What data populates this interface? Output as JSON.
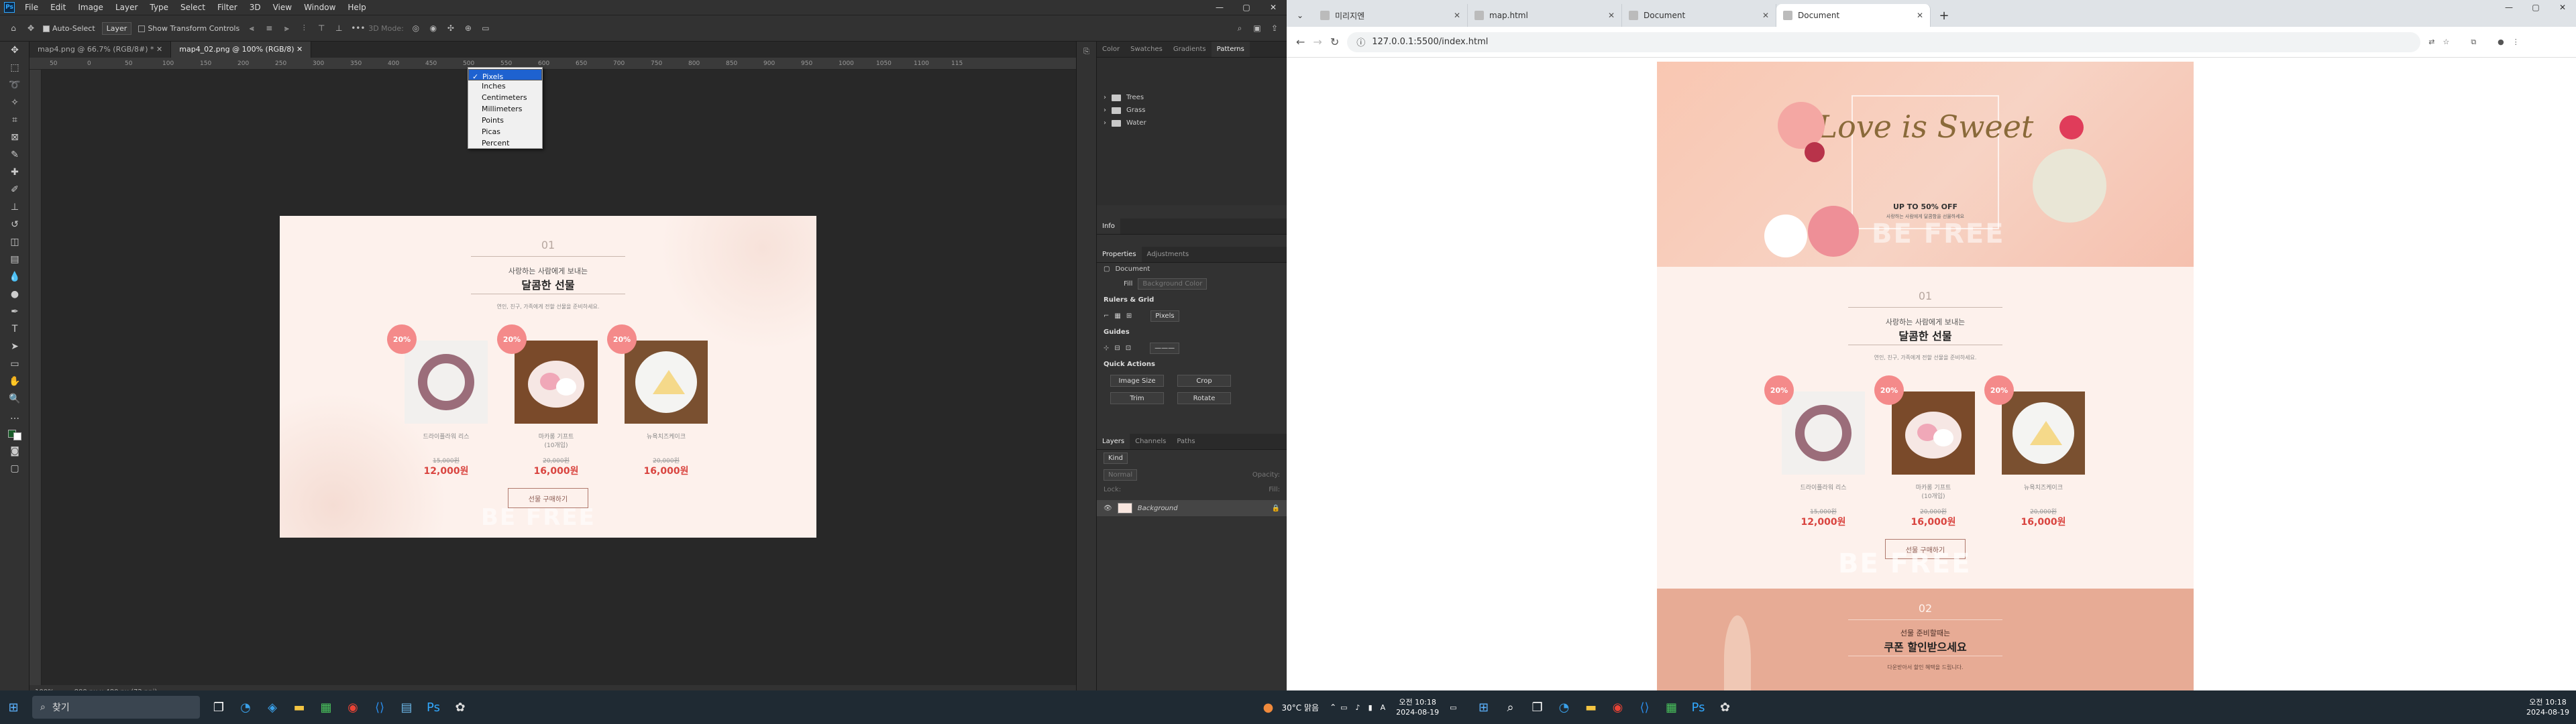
{
  "photoshop": {
    "menu": [
      "File",
      "Edit",
      "Image",
      "Layer",
      "Type",
      "Select",
      "Filter",
      "3D",
      "View",
      "Window",
      "Help"
    ],
    "options": {
      "auto_select": "Auto-Select",
      "layer_select": "Layer",
      "show_transform": "Show Transform Controls",
      "mode_3d": "3D Mode:"
    },
    "tabs": [
      "map4.png @ 66.7% (RGB/8#) *",
      "map4_02.png @ 100% (RGB/8)"
    ],
    "ruler_ticks": [
      "50",
      "0",
      "50",
      "100",
      "150",
      "200",
      "250",
      "300",
      "350",
      "400",
      "450",
      "500",
      "550",
      "600",
      "650",
      "700",
      "750",
      "800",
      "850",
      "900",
      "950",
      "1000",
      "1050",
      "1100",
      "115"
    ],
    "unit_menu": [
      "Pixels",
      "Inches",
      "Centimeters",
      "Millimeters",
      "Points",
      "Picas",
      "Percent"
    ],
    "status": {
      "zoom": "100%",
      "size": "800 px x 480 px (72 ppi)"
    },
    "panels": {
      "top_tabs": [
        "Color",
        "Swatches",
        "Gradients",
        "Patterns"
      ],
      "folders": [
        "Trees",
        "Grass",
        "Water"
      ],
      "info_tab": "Info",
      "props_tabs": [
        "Properties",
        "Adjustments"
      ],
      "doc_label": "Document",
      "fill_label": "Fill",
      "bg_color_label": "Background Color",
      "rulers_grid": "Rulers & Grid",
      "ruler_unit": "Pixels",
      "guides": "Guides",
      "quick_actions": "Quick Actions",
      "actions": [
        "Image Size",
        "Crop",
        "Trim",
        "Rotate"
      ],
      "layers_tabs": [
        "Layers",
        "Channels",
        "Paths"
      ],
      "kind": "Kind",
      "normal": "Normal",
      "opacity": "Opacity:",
      "lock": "Lock:",
      "fill2": "Fill:",
      "layer_name": "Background"
    }
  },
  "doc": {
    "num": "01",
    "sub": "사랑하는 사람에게 보내는",
    "title": "달콤한 선물",
    "desc": "연인, 친구, 가족에게 전할 선물을 준비하세요.",
    "products": [
      {
        "badge": "20%",
        "name": "드라이플라워 리스",
        "old": "15,000원",
        "new": "12,000원"
      },
      {
        "badge": "20%",
        "name": "마카롱 기프트\n(10개입)",
        "old": "20,000원",
        "new": "16,000원"
      },
      {
        "badge": "20%",
        "name": "뉴욕치즈케이크",
        "old": "20,000원",
        "new": "16,000원"
      }
    ],
    "button": "선물 구매하기",
    "watermark": "BE FREE",
    "hero_text": "Love is Sweet",
    "hero_sale": "UP TO 50% OFF",
    "hero_small": "사랑하는 사람에게 달콤함을 선물하세요",
    "num2": "02",
    "sub2": "선물 준비할때는",
    "title2": "쿠폰 할인받으세요",
    "desc2": "다운받아서 할인 혜택을 드립니다."
  },
  "browser": {
    "tabs": [
      "미리지엔",
      "map.html",
      "Document",
      "Document"
    ],
    "url": "127.0.0.1:5500/index.html"
  },
  "taskbar": {
    "search": "찾기",
    "weather": "30°C 맑음",
    "lang": "A",
    "left_time": "오전 10:18",
    "left_date": "2024-08-19",
    "right_time": "오전 10:18",
    "right_date": "2024-08-19"
  },
  "colors": {
    "ps_blue": "#31a8ff",
    "accent_red": "#d9443f",
    "badge": "#f48a8a",
    "doc_bg": "#fdf1ec"
  }
}
